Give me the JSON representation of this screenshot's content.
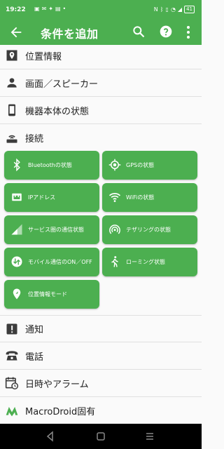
{
  "status": {
    "time": "19:22",
    "left_icons": [
      "line-icon",
      "mail-icon",
      "twitter-icon",
      "chat-icon",
      "dot"
    ],
    "right_icons": [
      "nfc-icon",
      "bluetooth-icon",
      "vibrate-icon",
      "wifi-icon",
      "signal-icon"
    ],
    "battery": "41"
  },
  "appbar": {
    "title": "条件を追加"
  },
  "rows_top": [
    {
      "label": "位置情報",
      "icon": "map-pin-icon"
    },
    {
      "label": "画面／スピーカー",
      "icon": "person-icon"
    },
    {
      "label": "機器本体の状態",
      "icon": "phone-icon"
    },
    {
      "label": "接続",
      "icon": "router-icon"
    }
  ],
  "tiles": [
    {
      "label": "Bluetoothの状態",
      "icon": "bluetooth-icon"
    },
    {
      "label": "GPSの状態",
      "icon": "gps-icon"
    },
    {
      "label": "IPアドレス",
      "icon": "ethernet-icon"
    },
    {
      "label": "WiFiの状態",
      "icon": "wifi-icon"
    },
    {
      "label": "サービス圏の通信状態",
      "icon": "cell-signal-icon"
    },
    {
      "label": "テザリングの状態",
      "icon": "hotspot-icon"
    },
    {
      "label": "モバイル通信のON／OFF",
      "icon": "data-swap-icon"
    },
    {
      "label": "ローミング状態",
      "icon": "walking-icon"
    },
    {
      "label": "位置情報モード",
      "icon": "location-icon"
    }
  ],
  "rows_bottom": [
    {
      "label": "通知",
      "icon": "alert-icon"
    },
    {
      "label": "電話",
      "icon": "telephone-icon"
    },
    {
      "label": "日時やアラーム",
      "icon": "calendar-clock-icon"
    },
    {
      "label": "MacroDroid固有",
      "icon": "macrodroid-icon"
    }
  ],
  "colors": {
    "primary": "#4caf50",
    "icon_dark": "#3c3c3c",
    "text": "#212121",
    "background": "#fafafa"
  }
}
